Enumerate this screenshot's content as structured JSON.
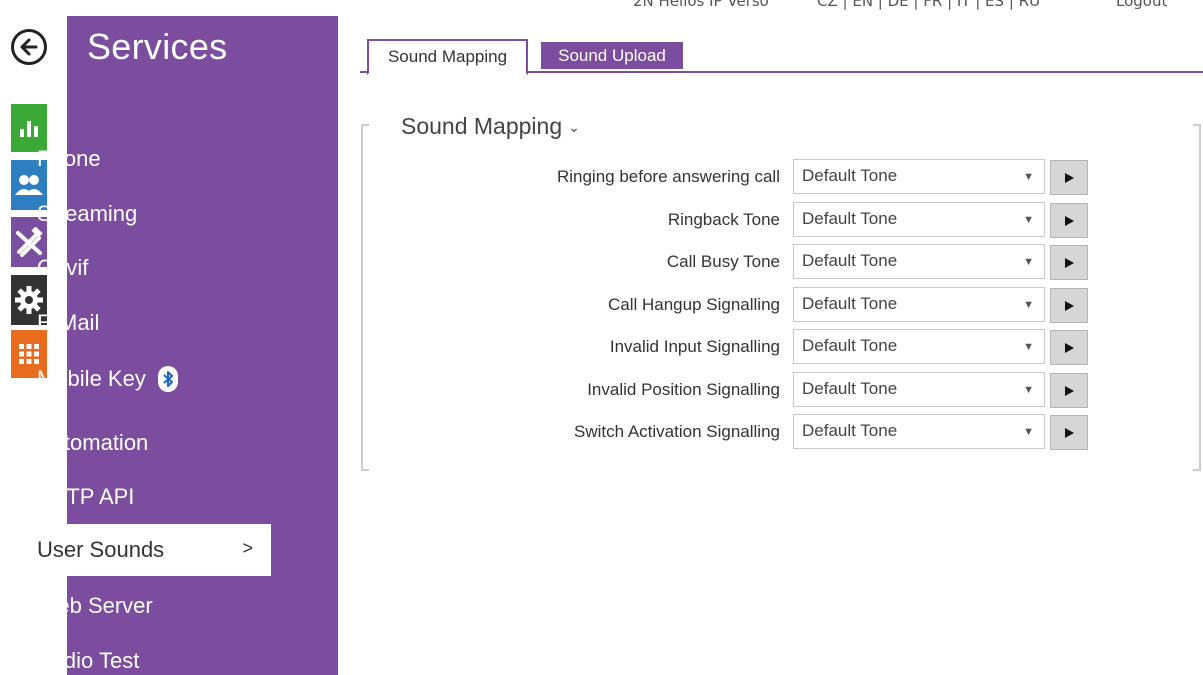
{
  "topbar": {
    "device_name": "2N Helios IP Verso",
    "languages": "CZ | EN | DE | FR | IT | ES | RU",
    "logout": "Logout"
  },
  "rail": {
    "icons": [
      "back-arrow-icon",
      "status-chart-icon",
      "directory-users-icon",
      "hardware-tools-icon",
      "services-gear-icon",
      "system-grid-icon"
    ],
    "colors": {
      "status": "#3aa935",
      "directory": "#2e7fc1",
      "hardware": "#7b4fa0",
      "services": "#333333",
      "system": "#e96b1e"
    }
  },
  "sidebar": {
    "title": "Services",
    "accent": "#7c4d9e",
    "items": [
      {
        "label": "Phone"
      },
      {
        "label": "Streaming"
      },
      {
        "label": "Onvif"
      },
      {
        "label": "E-Mail"
      },
      {
        "label": "Mobile Key",
        "icon": "bluetooth-icon"
      },
      {
        "label": "Automation"
      },
      {
        "label": "HTTP API"
      },
      {
        "label": "User Sounds",
        "active": true,
        "chevron": ">"
      },
      {
        "label": "Web Server"
      },
      {
        "label": "Audio Test"
      }
    ]
  },
  "tabs": [
    {
      "label": "Sound Mapping",
      "active": true
    },
    {
      "label": "Sound Upload",
      "active": false
    }
  ],
  "panel": {
    "title": "Sound Mapping",
    "caret": "⌄",
    "rows": [
      {
        "label": "Ringing before answering call",
        "value": "Default Tone"
      },
      {
        "label": "Ringback Tone",
        "value": "Default Tone"
      },
      {
        "label": "Call Busy Tone",
        "value": "Default Tone"
      },
      {
        "label": "Call Hangup Signalling",
        "value": "Default Tone"
      },
      {
        "label": "Invalid Input Signalling",
        "value": "Default Tone"
      },
      {
        "label": "Invalid Position Signalling",
        "value": "Default Tone"
      },
      {
        "label": "Switch Activation Signalling",
        "value": "Default Tone"
      }
    ]
  }
}
